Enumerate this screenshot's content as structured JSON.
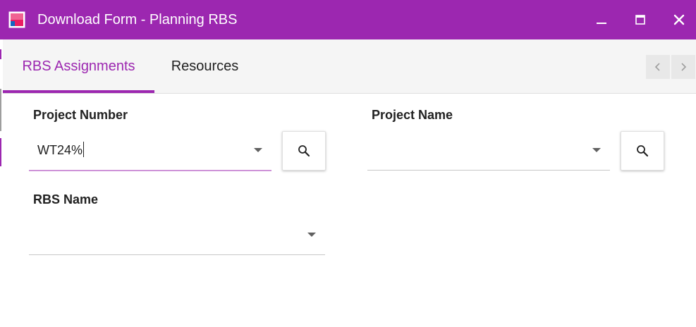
{
  "window": {
    "title": "Download Form - Planning RBS",
    "accent_color": "#9c27b0",
    "controls": [
      "minimize-icon",
      "maximize-icon",
      "close-icon"
    ]
  },
  "tabs": [
    {
      "label": "RBS Assignments",
      "active": true
    },
    {
      "label": "Resources",
      "active": false
    }
  ],
  "form": {
    "project_number": {
      "label": "Project Number",
      "value": "WT24%"
    },
    "project_name": {
      "label": "Project Name",
      "value": ""
    },
    "rbs_name": {
      "label": "RBS Name",
      "value": ""
    }
  },
  "icons": {
    "search": "search-icon",
    "dropdown": "chevron-down-icon",
    "tab_prev": "chevron-left-icon",
    "tab_next": "chevron-right-icon"
  }
}
